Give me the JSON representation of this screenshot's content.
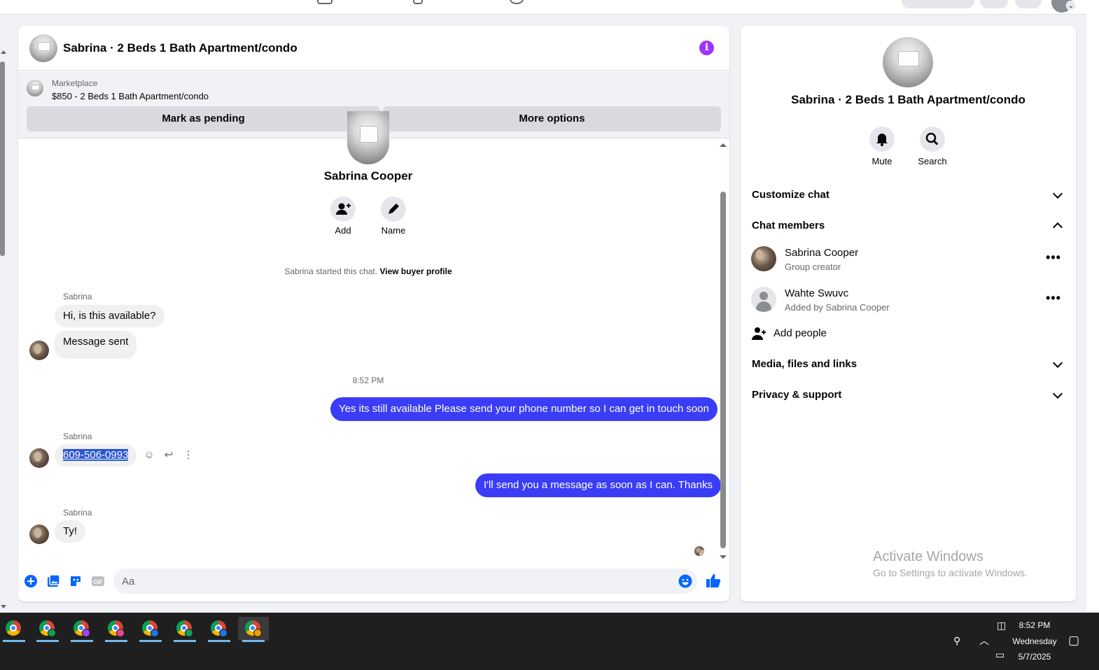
{
  "chat": {
    "title": "Sabrina · 2 Beds 1 Bath Apartment/condo",
    "info_icon": "i",
    "marketplace": {
      "label": "Marketplace",
      "item": "$850 - 2 Beds 1 Bath Apartment/condo",
      "mark_pending_label": "Mark as pending",
      "more_options_label": "More options"
    },
    "intro": {
      "name": "Sabrina Cooper",
      "add_label": "Add",
      "name_label": "Name",
      "started_text": "Sabrina started this chat.",
      "view_profile_label": "View buyer profile"
    },
    "messages": {
      "sender1": "Sabrina",
      "m1": "Hi, is this available?",
      "m2": "Message sent",
      "time": "8:52 PM",
      "out1": "Yes its still available Please send your phone number so I can get in touch soon",
      "sender2": "Sabrina",
      "m3": "609-506-0993",
      "out2": "I'll send you a message as soon as I can. Thanks",
      "sender3": "Sabrina",
      "m4": "Ty!"
    },
    "composer": {
      "placeholder": "Aa"
    }
  },
  "side": {
    "title": "Sabrina · 2 Beds 1 Bath Apartment/condo",
    "mute_label": "Mute",
    "search_label": "Search",
    "customize_label": "Customize chat",
    "members_label": "Chat members",
    "members": [
      {
        "name": "Sabrina Cooper",
        "sub": "Group creator"
      },
      {
        "name": "Wahte Swuvc",
        "sub": "Added by Sabrina Cooper"
      }
    ],
    "add_people_label": "Add people",
    "media_label": "Media, files and links",
    "privacy_label": "Privacy & support",
    "watermark_title": "Activate Windows",
    "watermark_sub": "Go to Settings to activate Windows."
  },
  "taskbar": {
    "time": "8:52 PM",
    "day": "Wednesday",
    "date": "5/7/2025",
    "badge_colors": [
      "#0f9d58",
      "#0f9d58",
      "#a142f4",
      "#e8478b",
      "#1a73e8",
      "#0f9d58",
      "#1a73e8",
      "#f29900"
    ]
  },
  "colors": {
    "accent": "#0866ff",
    "outgoing_bubble": "#3a3df5",
    "info_purple": "#a033ff"
  }
}
